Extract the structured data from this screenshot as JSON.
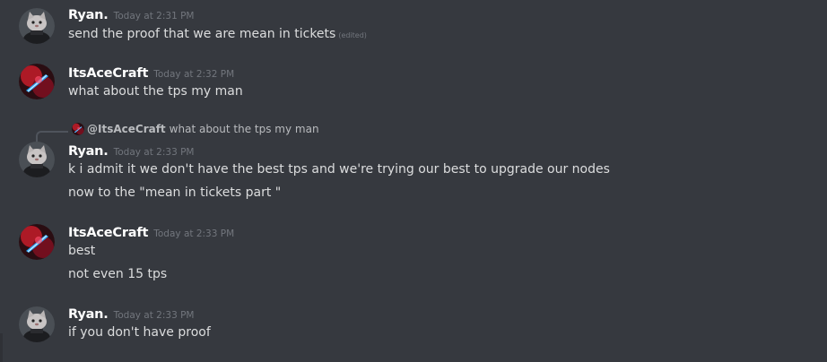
{
  "messages": [
    {
      "author": "Ryan.",
      "timestamp": "Today at 2:31 PM",
      "avatar_icon": "cat-avatar",
      "lines": [
        "send the proof that we are mean in tickets"
      ],
      "edited_label": "(edited)"
    },
    {
      "author": "ItsAceCraft",
      "timestamp": "Today at 2:32 PM",
      "avatar_icon": "red-blue-avatar",
      "lines": [
        "what about the tps my man"
      ]
    },
    {
      "author": "Ryan.",
      "timestamp": "Today at 2:33 PM",
      "avatar_icon": "cat-avatar",
      "reply": {
        "mention": "@ItsAceCraft",
        "text": "what about the tps my man"
      },
      "lines": [
        "k i admit it we don't have the best tps and we're trying our best to upgrade our nodes",
        "now to the \"mean in tickets part \""
      ]
    },
    {
      "author": "ItsAceCraft",
      "timestamp": "Today at 2:33 PM",
      "avatar_icon": "red-blue-avatar",
      "lines": [
        "best",
        "not even 15 tps"
      ]
    },
    {
      "author": "Ryan.",
      "timestamp": "Today at 2:33 PM",
      "avatar_icon": "cat-avatar",
      "lines": [
        "if you don't have proof"
      ]
    }
  ],
  "colors": {
    "background": "#36393f",
    "username": "#ffffff",
    "text": "#dcddde",
    "muted": "#72767d",
    "reply_text": "#b9bbbe"
  }
}
